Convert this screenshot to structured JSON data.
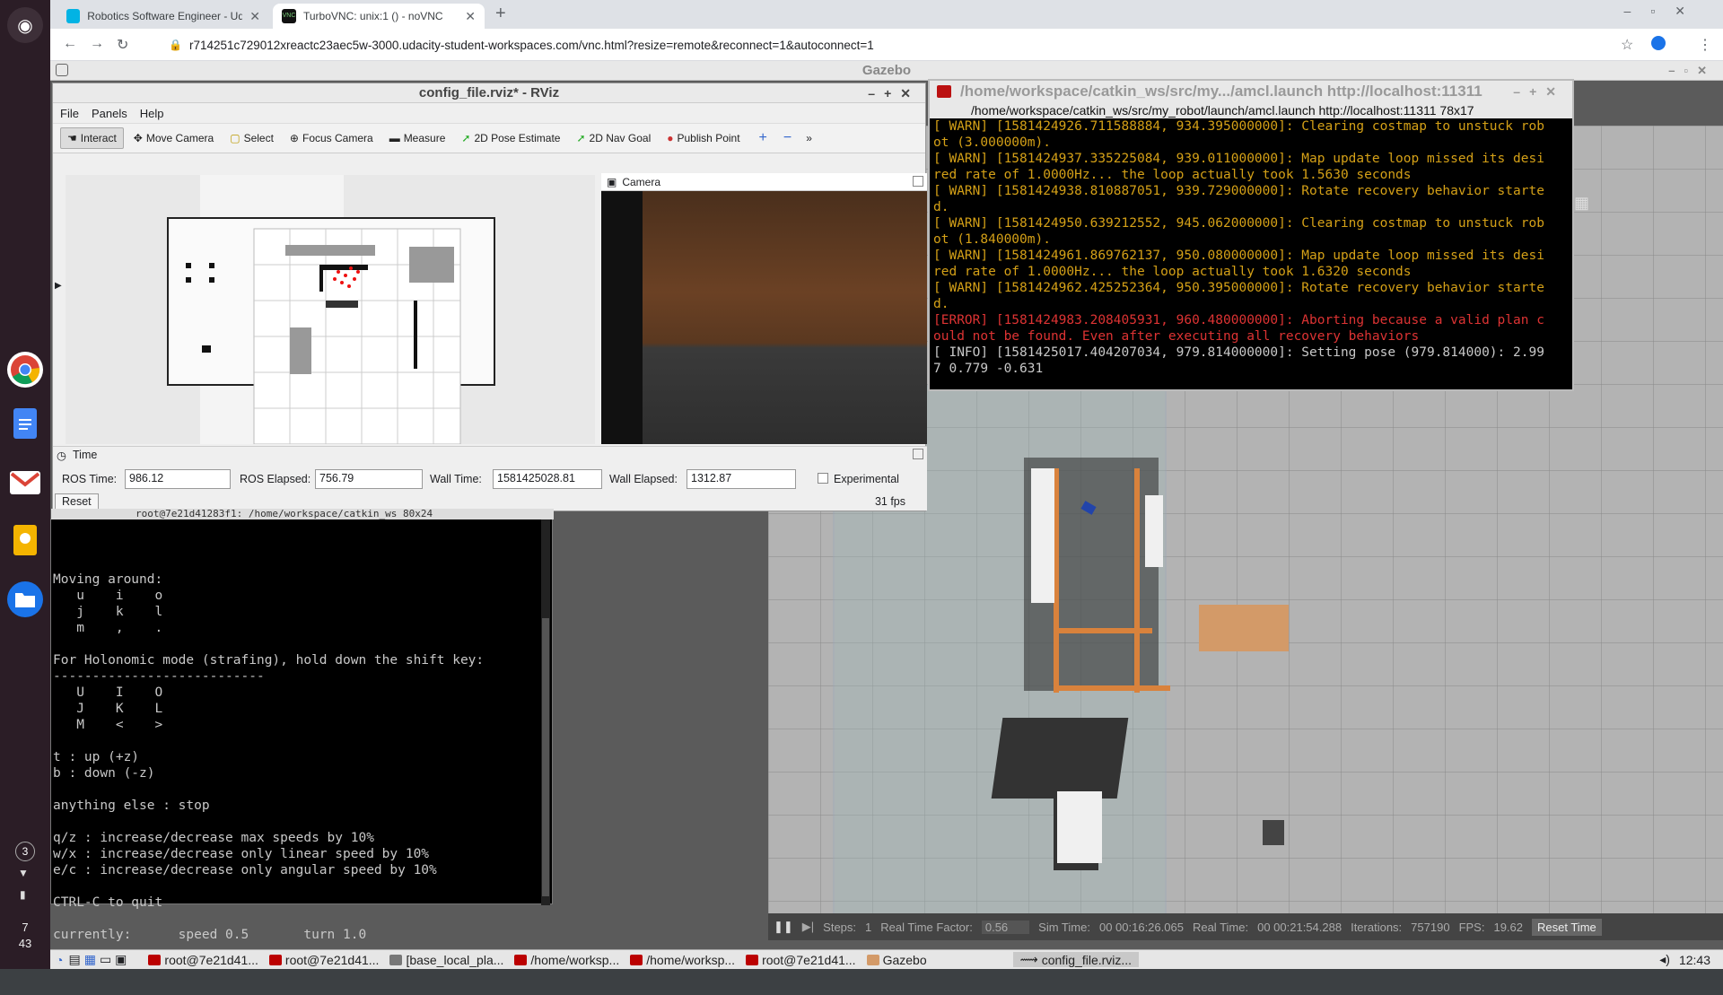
{
  "browser": {
    "tabs": [
      {
        "title": "Robotics Software Engineer - Uda"
      },
      {
        "title": "TurboVNC: unix:1 () - noVNC"
      }
    ],
    "url": "r714251c729012xreactc23aec5w-3000.udacity-student-workspaces.com/vnc.html?resize=remote&reconnect=1&autoconnect=1"
  },
  "shelf": {
    "apps": [
      "chrome-icon",
      "docs-icon",
      "gmail-icon",
      "keep-icon",
      "files-icon"
    ],
    "badge": "3",
    "clock_hour": "7",
    "clock_min": "43"
  },
  "gazebo": {
    "title": "Gazebo",
    "status": {
      "steps_label": "Steps:",
      "steps": "1",
      "rtf_label": "Real Time Factor:",
      "rtf": "0.56",
      "sim_label": "Sim Time:",
      "sim": "00 00:16:26.065",
      "real_label": "Real Time:",
      "real": "00 00:21:54.288",
      "iter_label": "Iterations:",
      "iter": "757190",
      "fps_label": "FPS:",
      "fps": "19.62",
      "reset": "Reset Time"
    }
  },
  "rviz": {
    "title": "config_file.rviz* - RViz",
    "menu": [
      "File",
      "Panels",
      "Help"
    ],
    "tools": [
      "Interact",
      "Move Camera",
      "Select",
      "Focus Camera",
      "Measure",
      "2D Pose Estimate",
      "2D Nav Goal",
      "Publish Point"
    ],
    "camera_label": "Camera",
    "time": {
      "header": "Time",
      "ros_time_label": "ROS Time:",
      "ros_time": "986.12",
      "ros_elapsed_label": "ROS Elapsed:",
      "ros_elapsed": "756.79",
      "wall_time_label": "Wall Time:",
      "wall_time": "1581425028.81",
      "wall_elapsed_label": "Wall Elapsed:",
      "wall_elapsed": "1312.87",
      "experimental": "Experimental",
      "reset": "Reset",
      "fps": "31 fps"
    }
  },
  "amcl_term": {
    "title": "/home/workspace/catkin_ws/src/my.../amcl.launch http://localhost:11311",
    "subtitle": "/home/workspace/catkin_ws/src/my_robot/launch/amcl.launch http://localhost:11311 78x17",
    "lines": [
      {
        "t": "[ WARN] [1581424926.711588884, 934.395000000]: Clearing costmap to unstuck rob",
        "c": "warn"
      },
      {
        "t": "ot (3.000000m).",
        "c": "warn"
      },
      {
        "t": "[ WARN] [1581424937.335225084, 939.011000000]: Map update loop missed its desi",
        "c": "warn"
      },
      {
        "t": "red rate of 1.0000Hz... the loop actually took 1.5630 seconds",
        "c": "warn"
      },
      {
        "t": "[ WARN] [1581424938.810887051, 939.729000000]: Rotate recovery behavior starte",
        "c": "warn"
      },
      {
        "t": "d.",
        "c": "warn"
      },
      {
        "t": "[ WARN] [1581424950.639212552, 945.062000000]: Clearing costmap to unstuck rob",
        "c": "warn"
      },
      {
        "t": "ot (1.840000m).",
        "c": "warn"
      },
      {
        "t": "[ WARN] [1581424961.869762137, 950.080000000]: Map update loop missed its desi",
        "c": "warn"
      },
      {
        "t": "red rate of 1.0000Hz... the loop actually took 1.6320 seconds",
        "c": "warn"
      },
      {
        "t": "[ WARN] [1581424962.425252364, 950.395000000]: Rotate recovery behavior starte",
        "c": "warn"
      },
      {
        "t": "d.",
        "c": "warn"
      },
      {
        "t": "[ERROR] [1581424983.208405931, 960.480000000]: Aborting because a valid plan c",
        "c": "err"
      },
      {
        "t": "ould not be found. Even after executing all recovery behaviors",
        "c": "err"
      },
      {
        "t": "[ INFO] [1581425017.404207034, 979.814000000]: Setting pose (979.814000): 2.99",
        "c": "info"
      },
      {
        "t": "7 0.779 -0.631",
        "c": "info"
      }
    ]
  },
  "teleop_term": {
    "title": "root@7e21d41283f1: /home/workspace/catkin_ws 80x24",
    "lines": [
      "Moving around:",
      "   u    i    o",
      "   j    k    l",
      "   m    ,    .",
      "",
      "For Holonomic mode (strafing), hold down the shift key:",
      "---------------------------",
      "   U    I    O",
      "   J    K    L",
      "   M    <    >",
      "",
      "t : up (+z)",
      "b : down (-z)",
      "",
      "anything else : stop",
      "",
      "q/z : increase/decrease max speeds by 10%",
      "w/x : increase/decrease only linear speed by 10%",
      "e/c : increase/decrease only angular speed by 10%",
      "",
      "CTRL-C to quit",
      "",
      "currently:      speed 0.5       turn 1.0"
    ]
  },
  "taskbar": {
    "items": [
      "root@7e21d41...",
      "root@7e21d41...",
      "[base_local_pla...",
      "/home/worksp...",
      "/home/worksp...",
      "root@7e21d41...",
      "Gazebo",
      "config_file.rviz..."
    ],
    "clock": "12:43"
  }
}
